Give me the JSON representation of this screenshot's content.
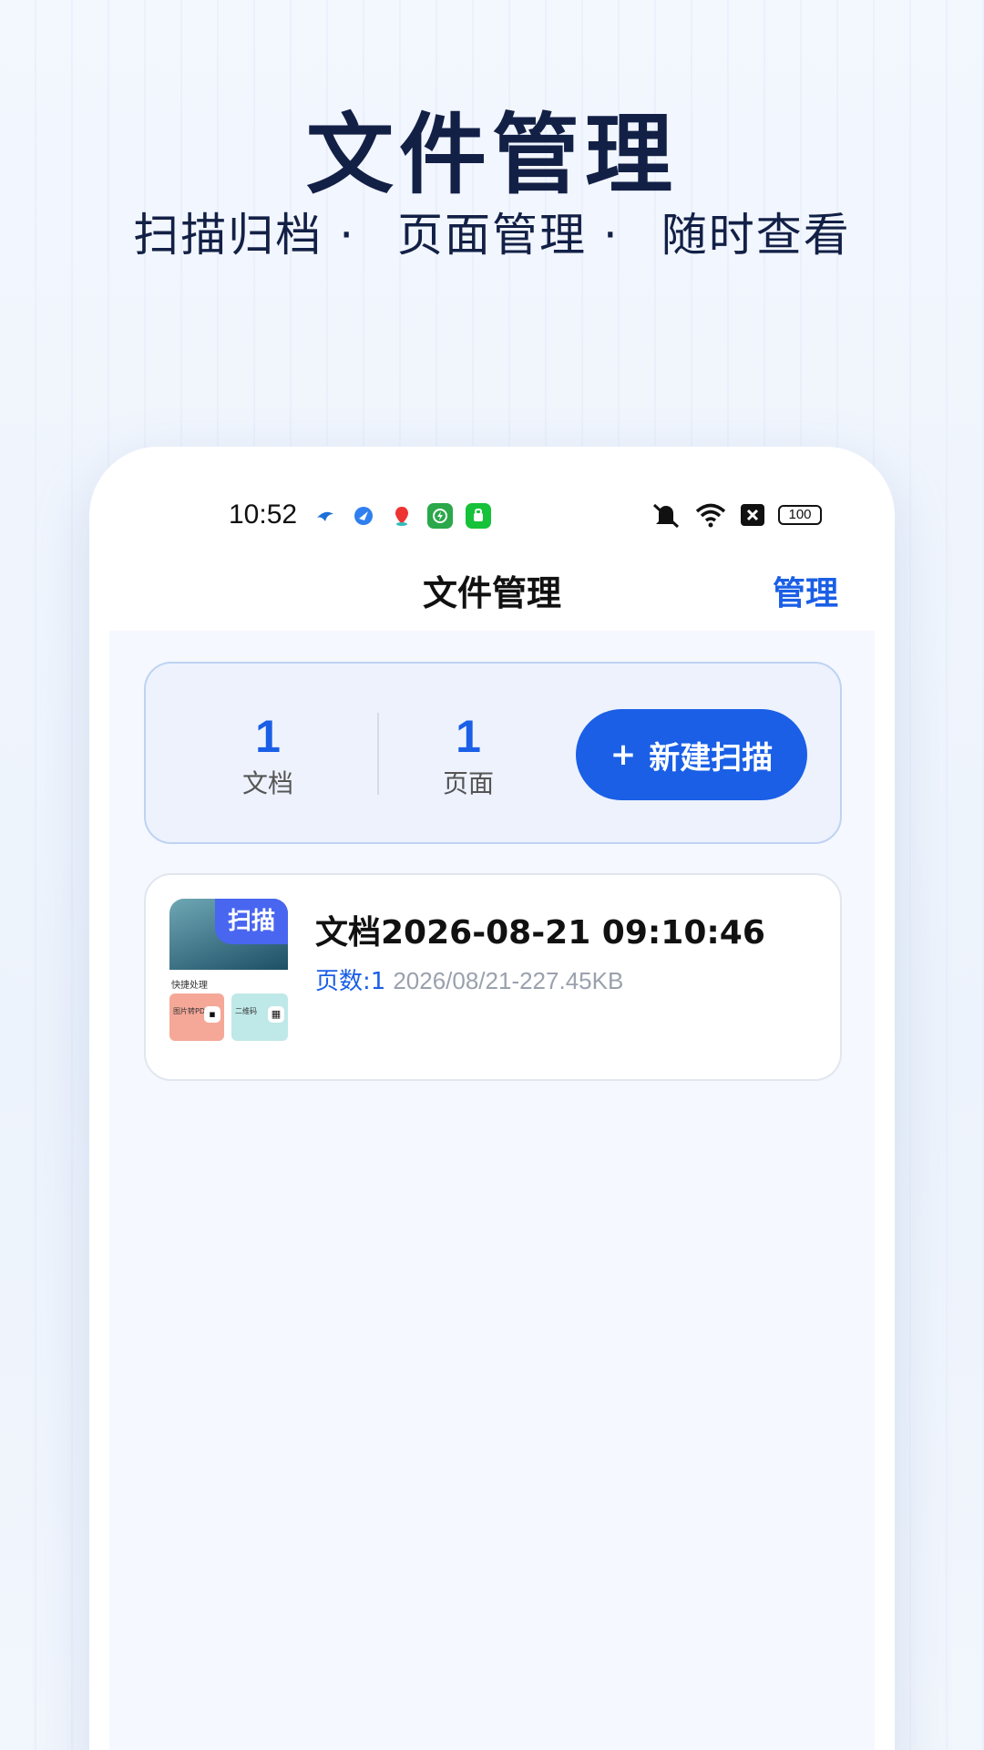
{
  "promo": {
    "title": "文件管理",
    "subtitle_items": [
      "扫描归档 ·",
      "页面管理 ·",
      "随时查看"
    ]
  },
  "statusbar": {
    "time": "10:52",
    "battery": "100",
    "icons": [
      "app-icon-1",
      "app-icon-2",
      "map-app-icon",
      "app-icon-4",
      "app-icon-5",
      "mute-icon",
      "wifi-icon",
      "sim-blocked-icon",
      "battery-icon"
    ]
  },
  "navbar": {
    "title": "文件管理",
    "manage_label": "管理"
  },
  "stats": {
    "documents_count": "1",
    "documents_label": "文档",
    "pages_count": "1",
    "pages_label": "页面",
    "new_scan_plus": "+",
    "new_scan_label": "新建扫描"
  },
  "documents": [
    {
      "thumb_tag": "扫描",
      "thumb_caption": "快捷处理",
      "thumb_tile1": "图片转PDF",
      "thumb_tile2": "二维码",
      "title": "文档2026-08-21 09:10:46",
      "pages_text": "页数:1",
      "info_text": "2026/08/21-227.45KB"
    }
  ],
  "colors": {
    "accent": "#1a5fe6",
    "title_text": "#132046",
    "meta_gray": "#9aa1ad"
  }
}
